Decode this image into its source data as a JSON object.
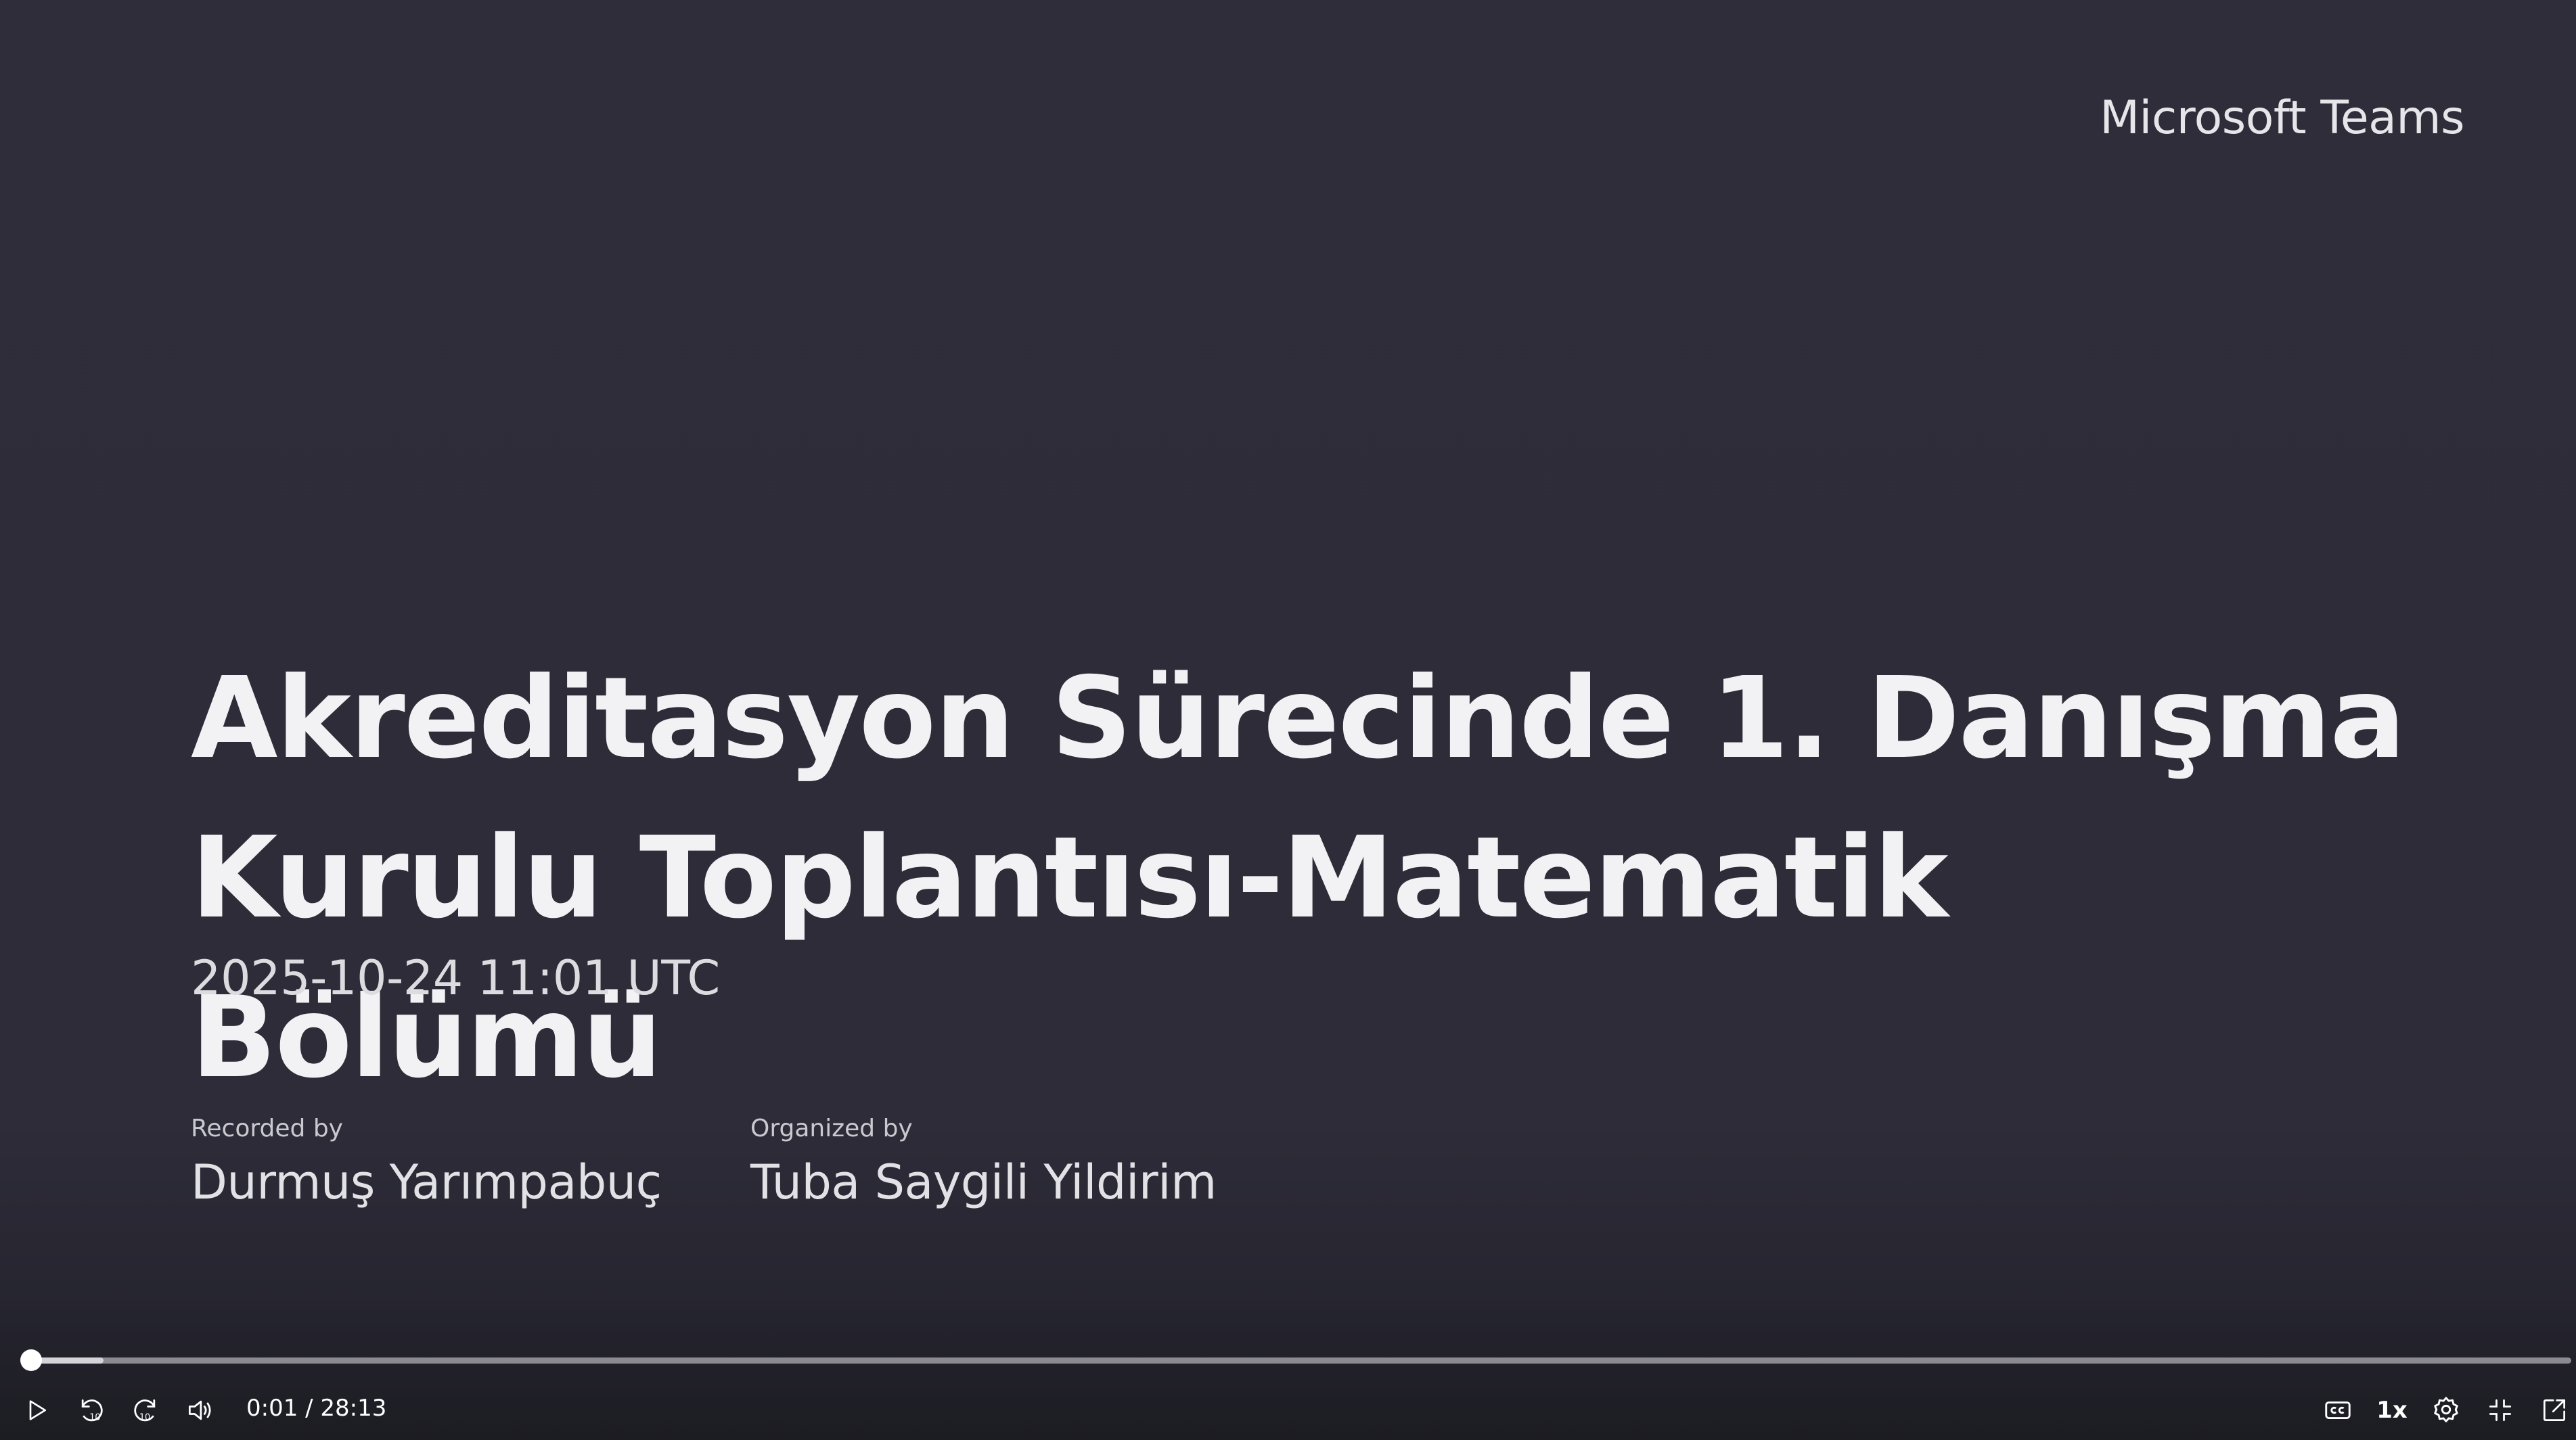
{
  "slide": {
    "brand": "Microsoft Teams",
    "title": "Akreditasyon Sürecinde 1. Danışma Kurulu Toplantısı-Matematik Bölümü",
    "datetime": "2025-10-24 11:01 UTC",
    "recorded_caption": "Recorded by",
    "recorded_name": "Durmuş Yarımpabuç",
    "organized_caption": "Organized by",
    "organized_name": "Tuba Saygili Yildirim"
  },
  "player": {
    "current_time": "0:01",
    "duration": "28:13",
    "time_display": "0:01 / 28:13",
    "speed_label": "1x",
    "progress_fraction": 0.0006,
    "buffered_fraction": 0.03,
    "icons": {
      "play": "play-icon",
      "rewind": "rewind-10-icon",
      "forward": "forward-10-icon",
      "volume": "volume-icon",
      "captions": "captions-icon",
      "settings": "gear-icon",
      "fullscreen": "exit-fullscreen-icon",
      "popout": "pop-out-icon"
    },
    "colors": {
      "background": "#2d2c38",
      "text": "#ffffff",
      "track": "#8a8a90"
    }
  }
}
